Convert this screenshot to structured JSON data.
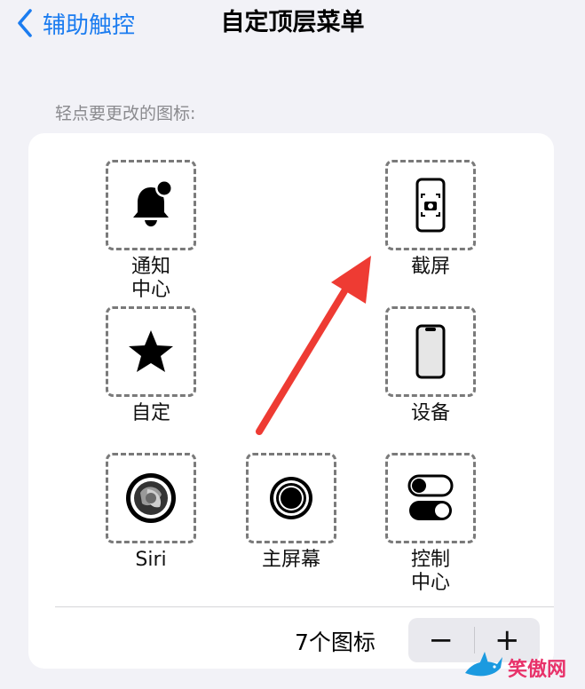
{
  "nav": {
    "back_label": "辅助触控",
    "title": "自定顶层菜单"
  },
  "section_label": "轻点要更改的图标:",
  "icons": [
    {
      "label": "通知\n中心",
      "icon": "notification-bell-icon"
    },
    {
      "label": "截屏",
      "icon": "screenshot-icon"
    },
    {
      "label": "自定",
      "icon": "star-icon"
    },
    {
      "label": "设备",
      "icon": "device-phone-icon"
    },
    {
      "label": "Siri",
      "icon": "siri-icon"
    },
    {
      "label": "主屏幕",
      "icon": "home-button-icon"
    },
    {
      "label": "控制\n中心",
      "icon": "control-center-toggles-icon"
    }
  ],
  "footer": {
    "count_label": "7个图标",
    "minus_label": "−",
    "plus_label": "+"
  },
  "watermark": {
    "text": "笑傲网"
  },
  "colors": {
    "accent": "#1b7cf0",
    "background": "#f2f2f7",
    "card": "#ffffff",
    "annotation_arrow": "#ee3b33"
  }
}
